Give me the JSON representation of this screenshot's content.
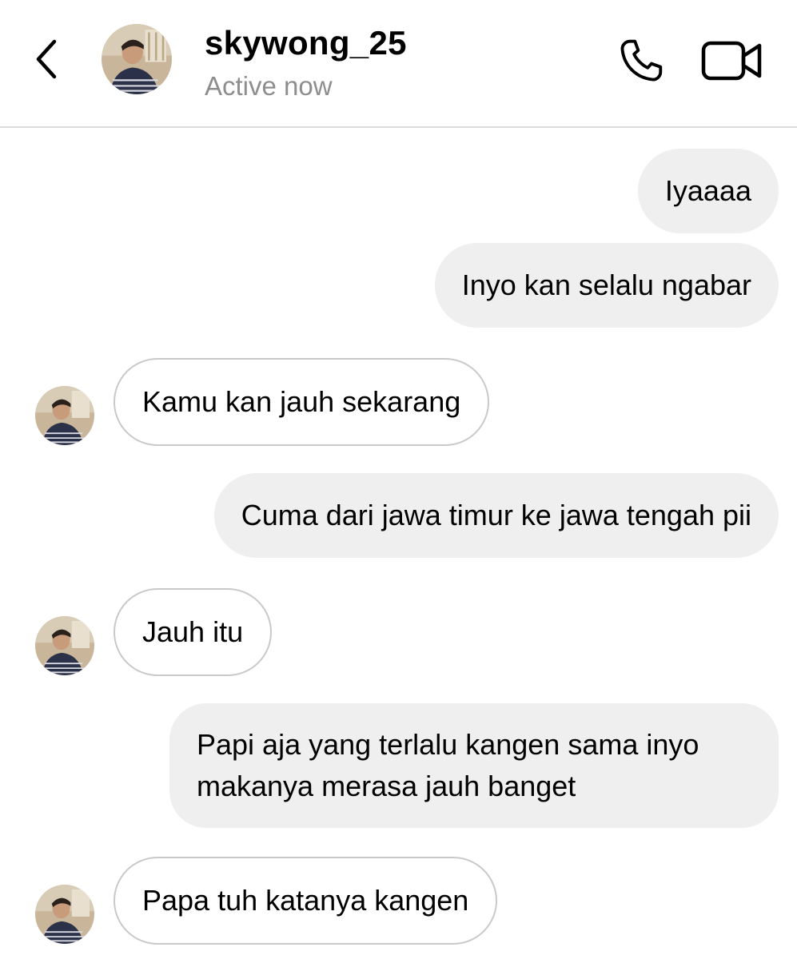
{
  "header": {
    "username": "skywong_25",
    "status": "Active now",
    "icons": {
      "back": "chevron-left-icon",
      "call": "phone-icon",
      "video": "video-camera-icon"
    }
  },
  "colors": {
    "sent_bubble": "#efefef",
    "received_border": "#c9c9c9",
    "status_text": "#8e8e8e",
    "divider": "#dbdbdb"
  },
  "messages": [
    {
      "direction": "sent",
      "text": "Iyaaaa"
    },
    {
      "direction": "sent",
      "text": "Inyo kan selalu ngabar"
    },
    {
      "direction": "received",
      "text": "Kamu kan jauh sekarang"
    },
    {
      "direction": "sent",
      "text": "Cuma dari jawa timur ke jawa tengah pii"
    },
    {
      "direction": "received",
      "text": "Jauh itu"
    },
    {
      "direction": "sent",
      "text": "Papi aja yang terlalu kangen sama inyo makanya merasa jauh banget"
    },
    {
      "direction": "received",
      "text": "Papa tuh katanya kangen"
    }
  ]
}
